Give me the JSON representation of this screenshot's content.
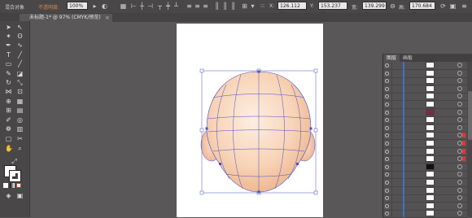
{
  "control_bar": {
    "object_type": "混合对象",
    "opacity_label": "不透明度:",
    "opacity_value": "100%",
    "x_label": "X:",
    "x_value": "126.112 m",
    "y_label": "Y:",
    "y_value": "153.237 m",
    "w_label": "宽:",
    "w_value": "139.299 m",
    "h_label": "高:",
    "h_value": "170.684 m"
  },
  "document": {
    "tab_title": "未标题-1* @ 97% (CMYK/预览)",
    "close_icon": "×"
  },
  "layers_panel": {
    "tabs": [
      "图层",
      "画板"
    ],
    "active_tab": 0,
    "row_count": 20,
    "selection_color": "#d63a3a",
    "layer_color": "#3e6fd0"
  },
  "colors": {
    "ui_bg": "#5a5758",
    "panel_bg": "#4a4748",
    "skin_light": "#fde7d6",
    "skin_dark": "#f0b88e",
    "path_color": "#4a4ec8"
  }
}
